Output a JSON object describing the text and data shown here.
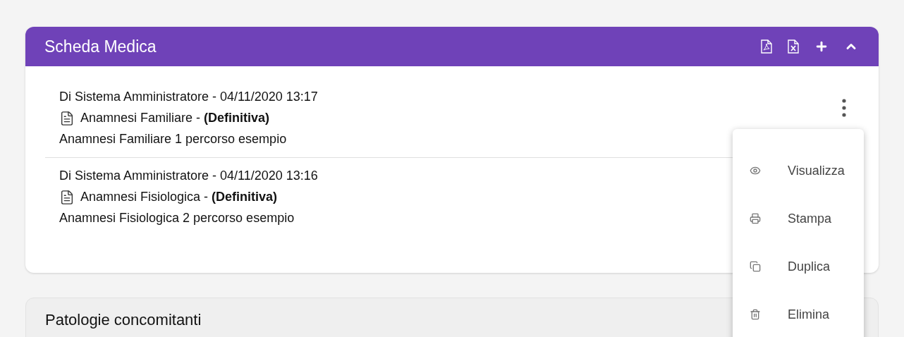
{
  "card": {
    "title": "Scheda Medica",
    "entries": [
      {
        "meta": "Di Sistema Amministratore - 04/11/2020 13:17",
        "title": "Anamnesi Familiare - **(Definitiva)**",
        "description": "Anamnesi Familiare 1 percorso esempio"
      },
      {
        "meta": "Di Sistema Amministratore - 04/11/2020 13:16",
        "title": "Anamnesi Fisiologica - **(Definitiva)**",
        "description": "Anamnesi Fisiologica 2 percorso esempio"
      }
    ]
  },
  "menu": [
    {
      "kind": "view",
      "label": "Visualizza"
    },
    {
      "kind": "print",
      "label": "Stampa"
    },
    {
      "kind": "duplicate",
      "label": "Duplica"
    },
    {
      "kind": "delete",
      "label": "Elimina"
    }
  ],
  "second_card": {
    "title": "Patologie concomitanti"
  }
}
